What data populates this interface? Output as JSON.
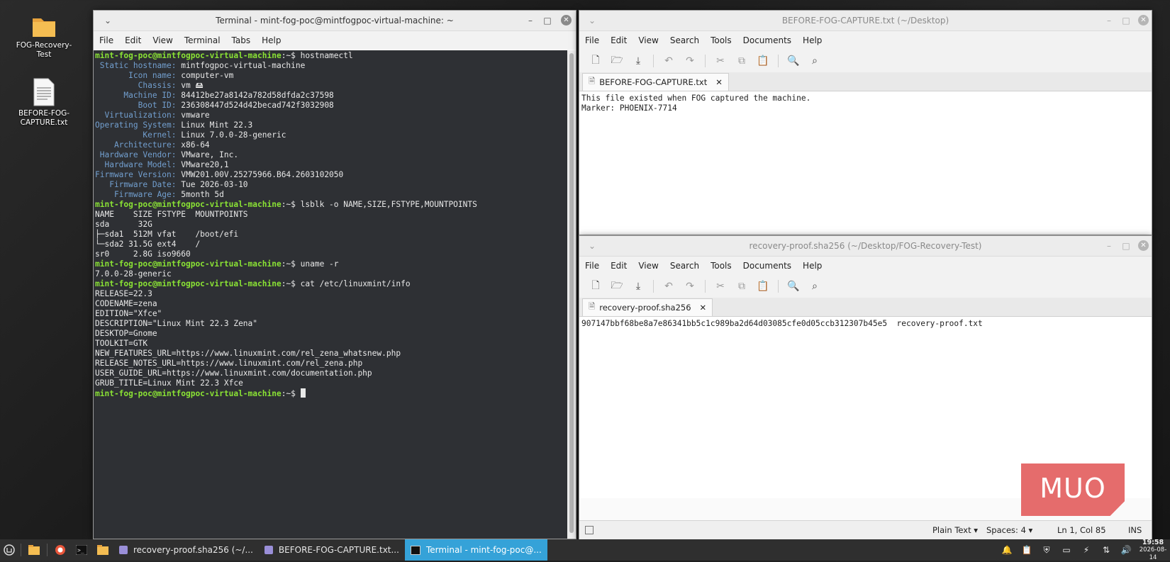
{
  "desktop": {
    "icons": [
      {
        "label": "FOG-Recovery-Test",
        "icon": "folder-icon"
      },
      {
        "label": "BEFORE-FOG-CAPTURE.txt",
        "icon": "text-file-icon"
      }
    ]
  },
  "terminal": {
    "title": "Terminal - mint-fog-poc@mintfogpoc-virtual-machine: ~",
    "menu": [
      "File",
      "Edit",
      "View",
      "Terminal",
      "Tabs",
      "Help"
    ],
    "prompt": "mint-fog-poc@mintfogpoc-virtual-machine",
    "prompt_suffix": ":~$ ",
    "lines": [
      {
        "type": "cmd",
        "text": "hostnamectl"
      },
      {
        "type": "kv",
        "key": " Static hostname:",
        "val": " mintfogpoc-virtual-machine"
      },
      {
        "type": "kv",
        "key": "       Icon name:",
        "val": " computer-vm"
      },
      {
        "type": "kv",
        "key": "         Chassis:",
        "val": " vm 🖴"
      },
      {
        "type": "kv",
        "key": "      Machine ID:",
        "val": " 84412be27a8142a782d58dfda2c37598"
      },
      {
        "type": "kv",
        "key": "         Boot ID:",
        "val": " 236308447d524d42becad742f3032908"
      },
      {
        "type": "kv",
        "key": "  Virtualization:",
        "val": " vmware"
      },
      {
        "type": "kv",
        "key": "Operating System:",
        "val": " Linux Mint 22.3"
      },
      {
        "type": "kv",
        "key": "          Kernel:",
        "val": " Linux 7.0.0-28-generic"
      },
      {
        "type": "kv",
        "key": "    Architecture:",
        "val": " x86-64"
      },
      {
        "type": "kv",
        "key": " Hardware Vendor:",
        "val": " VMware, Inc."
      },
      {
        "type": "kv",
        "key": "  Hardware Model:",
        "val": " VMware20,1"
      },
      {
        "type": "kv",
        "key": "Firmware Version:",
        "val": " VMW201.00V.25275966.B64.2603102050"
      },
      {
        "type": "kv",
        "key": "   Firmware Date:",
        "val": " Tue 2026-03-10"
      },
      {
        "type": "kv",
        "key": "    Firmware Age:",
        "val": " 5month 5d"
      },
      {
        "type": "cmd",
        "text": "lsblk -o NAME,SIZE,FSTYPE,MOUNTPOINTS"
      },
      {
        "type": "out",
        "text": "NAME    SIZE FSTYPE  MOUNTPOINTS"
      },
      {
        "type": "out",
        "text": "sda      32G"
      },
      {
        "type": "out",
        "text": "├─sda1  512M vfat    /boot/efi"
      },
      {
        "type": "out",
        "text": "└─sda2 31.5G ext4    /"
      },
      {
        "type": "out",
        "text": "sr0     2.8G iso9660"
      },
      {
        "type": "cmd",
        "text": "uname -r"
      },
      {
        "type": "out",
        "text": "7.0.0-28-generic"
      },
      {
        "type": "cmd",
        "text": "cat /etc/linuxmint/info"
      },
      {
        "type": "out",
        "text": "RELEASE=22.3"
      },
      {
        "type": "out",
        "text": "CODENAME=zena"
      },
      {
        "type": "out",
        "text": "EDITION=\"Xfce\""
      },
      {
        "type": "out",
        "text": "DESCRIPTION=\"Linux Mint 22.3 Zena\""
      },
      {
        "type": "out",
        "text": "DESKTOP=Gnome"
      },
      {
        "type": "out",
        "text": "TOOLKIT=GTK"
      },
      {
        "type": "out",
        "text": "NEW_FEATURES_URL=https://www.linuxmint.com/rel_zena_whatsnew.php"
      },
      {
        "type": "out",
        "text": "RELEASE_NOTES_URL=https://www.linuxmint.com/rel_zena.php"
      },
      {
        "type": "out",
        "text": "USER_GUIDE_URL=https://www.linuxmint.com/documentation.php"
      },
      {
        "type": "out",
        "text": "GRUB_TITLE=Linux Mint 22.3 Xfce"
      },
      {
        "type": "prompt_cursor",
        "text": ""
      }
    ]
  },
  "editor1": {
    "title": "BEFORE-FOG-CAPTURE.txt (~/Desktop)",
    "menu": [
      "File",
      "Edit",
      "View",
      "Search",
      "Tools",
      "Documents",
      "Help"
    ],
    "tab": "BEFORE-FOG-CAPTURE.txt",
    "content": "This file existed when FOG captured the machine.\nMarker: PHOENIX-7714"
  },
  "editor2": {
    "title": "recovery-proof.sha256 (~/Desktop/FOG-Recovery-Test)",
    "menu": [
      "File",
      "Edit",
      "View",
      "Search",
      "Tools",
      "Documents",
      "Help"
    ],
    "tab": "recovery-proof.sha256",
    "content": "907147bbf68be8a7e86341bb5c1c989ba2d64d03085cfe0d05ccb312307b45e5  recovery-proof.txt",
    "status": {
      "filetype": "Plain Text",
      "spaces": "Spaces: 4",
      "position": "Ln 1, Col 85",
      "mode": "INS"
    }
  },
  "taskbar": {
    "tasks": [
      {
        "label": "recovery-proof.sha256 (~/...",
        "active": false
      },
      {
        "label": "BEFORE-FOG-CAPTURE.txt...",
        "active": false
      },
      {
        "label": "Terminal - mint-fog-poc@...",
        "active": true
      }
    ],
    "clock_time": "19:58",
    "clock_date": "2026-08-14"
  },
  "watermark": "MUO"
}
